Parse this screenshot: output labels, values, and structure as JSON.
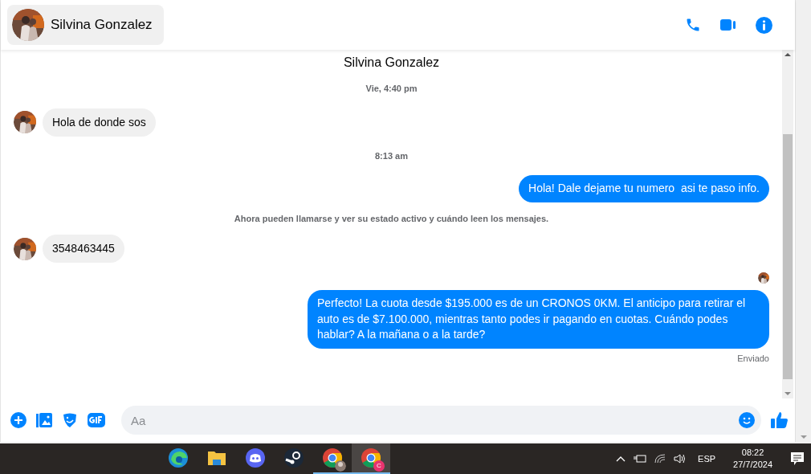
{
  "header": {
    "contact_name": "Silvina Gonzalez"
  },
  "messages": [
    {
      "kind": "name_heading",
      "text": "Silvina Gonzalez"
    },
    {
      "kind": "timestamp",
      "text": "Vie, 4:40 pm"
    },
    {
      "kind": "incoming",
      "text": "Hola de donde sos"
    },
    {
      "kind": "timestamp",
      "text": "8:13 am"
    },
    {
      "kind": "outgoing",
      "text": "Hola! Dale dejame tu numero  asi te paso info."
    },
    {
      "kind": "notice",
      "text": "Ahora pueden llamarse y ver su estado activo y cuándo leen los mensajes."
    },
    {
      "kind": "incoming",
      "text": "3548463445"
    },
    {
      "kind": "seen"
    },
    {
      "kind": "outgoing",
      "text": "Perfecto! La cuota desde $195.000 es de un CRONOS 0KM. El anticipo para retirar el auto es de $7.100.000, mientras tanto podes ir pagando en cuotas. Cuándo podes hablar? A la mañana o a la tarde?"
    },
    {
      "kind": "status",
      "text": "Enviado"
    }
  ],
  "composer": {
    "placeholder": "Aa"
  },
  "taskbar": {
    "apps": [
      {
        "kind": "edge",
        "open": false,
        "selected": false
      },
      {
        "kind": "explorer",
        "open": false,
        "selected": false
      },
      {
        "kind": "discord",
        "open": false,
        "selected": false
      },
      {
        "kind": "steam",
        "open": false,
        "selected": false
      },
      {
        "kind": "chrome",
        "open": true,
        "selected": false
      },
      {
        "kind": "chrome_profile",
        "badge": "C",
        "open": true,
        "selected": true
      }
    ],
    "language": "ESP",
    "time": "08:22",
    "date": "27/7/2024"
  }
}
